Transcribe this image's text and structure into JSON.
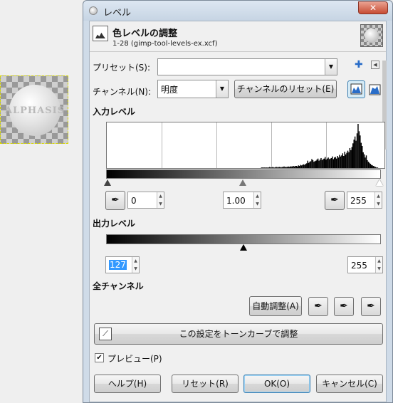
{
  "canvas": {
    "thumbnail_text": "ALPHASIS"
  },
  "window": {
    "title": "レベル",
    "close_label": "✕"
  },
  "header": {
    "title": "色レベルの調整",
    "subtitle": "1-28 (gimp-tool-levels-ex.xcf)"
  },
  "preset": {
    "label": "プリセット(S):",
    "value": "",
    "add_icon": "plus-icon",
    "menu_icon": "menu-icon"
  },
  "channel": {
    "label": "チャンネル(N):",
    "value": "明度",
    "reset_label": "チャンネルのリセット(E)"
  },
  "input_levels": {
    "title": "入力レベル",
    "low": "0",
    "gamma": "1.00",
    "high": "255",
    "gamma_position": 0.5
  },
  "output_levels": {
    "title": "出力レベル",
    "low": "127",
    "high": "255",
    "low_position": 0.498
  },
  "all_channels": {
    "title": "全チャンネル",
    "auto_label": "自動調整(A)"
  },
  "curves_button": {
    "label": "この設定をトーンカーブで調整"
  },
  "preview": {
    "label": "プレビュー(P)",
    "checked": true
  },
  "footer": {
    "help": "ヘルプ(H)",
    "reset": "リセット(R)",
    "ok": "OK(O)",
    "cancel": "キャンセル(C)"
  },
  "histogram": {
    "bins": [
      0,
      0,
      0,
      0,
      0,
      0,
      0,
      0,
      0,
      0,
      0,
      0,
      0,
      0,
      0,
      0,
      0,
      0,
      0,
      0,
      0,
      0,
      0,
      0,
      0,
      0,
      0,
      0,
      0,
      0,
      0,
      0,
      0,
      0,
      0,
      0,
      0,
      0,
      0,
      0,
      0,
      0,
      0,
      0,
      0,
      0,
      0,
      0,
      0,
      0,
      0,
      0,
      0,
      0,
      0,
      0,
      0,
      0,
      0,
      0,
      0,
      0,
      0,
      0,
      0,
      0,
      0,
      0,
      0,
      0,
      0,
      0,
      0,
      0,
      0,
      0,
      0,
      0,
      0,
      0,
      0,
      0,
      0,
      0,
      0,
      0,
      0,
      0,
      0,
      0,
      0,
      0,
      0,
      0,
      0,
      0,
      0,
      0,
      0,
      0,
      0,
      0,
      0,
      0,
      0,
      0,
      0,
      0,
      0,
      0,
      0,
      0,
      0,
      0,
      0,
      0,
      0,
      0,
      0,
      0,
      0,
      0,
      0,
      0,
      0,
      0,
      0,
      0,
      0,
      0,
      0,
      0,
      0,
      0,
      0,
      0,
      0,
      0,
      0,
      0,
      0,
      0,
      0,
      0,
      0,
      0,
      0,
      0,
      0,
      0,
      1,
      1,
      1,
      1,
      1,
      1,
      1,
      1,
      2,
      1,
      1,
      2,
      1,
      1,
      2,
      2,
      1,
      2,
      2,
      1,
      2,
      2,
      3,
      2,
      2,
      2,
      3,
      2,
      3,
      3,
      3,
      4,
      3,
      4,
      4,
      3,
      5,
      4,
      6,
      5,
      6,
      7,
      6,
      8,
      9,
      14,
      10,
      12,
      13,
      17,
      15,
      12,
      13,
      14,
      16,
      18,
      14,
      16,
      19,
      15,
      17,
      18,
      21,
      16,
      18,
      20,
      17,
      18,
      19,
      22,
      17,
      20,
      21,
      18,
      23,
      20,
      25,
      22,
      24,
      28,
      23,
      31,
      26,
      29,
      33,
      30,
      38,
      34,
      40,
      47,
      54,
      60,
      52,
      66,
      84,
      70,
      62,
      48,
      42,
      30,
      26,
      20,
      24,
      15,
      12,
      10,
      8,
      6,
      5,
      4,
      3,
      2,
      1,
      1,
      0,
      0
    ]
  }
}
